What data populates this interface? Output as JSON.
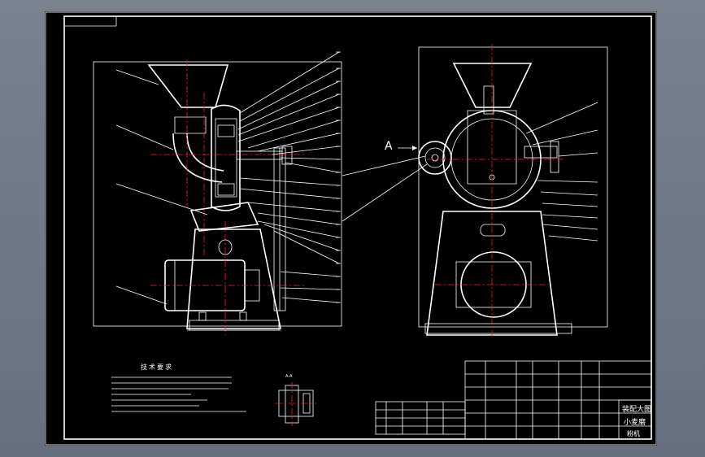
{
  "drawing": {
    "view_label": "A",
    "section_label": "A-A",
    "tech_req_title": "技术要求",
    "title_block": {
      "line1": "装配大图",
      "line2": "小麦磨",
      "line3": "粉机"
    }
  },
  "colors": {
    "background": "#000000",
    "line": "#ffffff",
    "center_line": "#ff2020",
    "desktop": "#6f7682"
  }
}
